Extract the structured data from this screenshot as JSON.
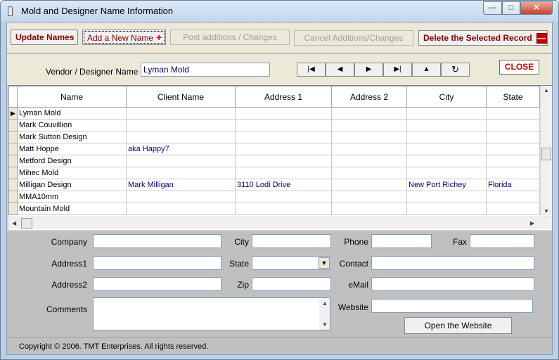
{
  "window": {
    "title": "Mold and Designer Name Information",
    "controls": {
      "minimize": "—",
      "maximize": "□",
      "close": "✕"
    }
  },
  "toolbar": {
    "update_names": "Update Names",
    "add_new_name": "Add a New Name",
    "add_icon": "+",
    "post_changes": "Post additions / Changes",
    "cancel_changes": "Cancel Additions/Changes",
    "delete_record": "Delete the Selected Record",
    "delete_icon": "—"
  },
  "vendor": {
    "label": "Vendor /  Designer Name",
    "value": "Lyman Mold"
  },
  "nav": {
    "first": "|◀",
    "prev": "◀",
    "next": "▶",
    "last": "▶|",
    "up": "▲",
    "refresh": "↻"
  },
  "close_button": "CLOSE",
  "grid": {
    "columns": [
      "Name",
      "Client Name",
      "Address 1",
      "Address 2",
      "City",
      "State"
    ],
    "current_row_marker": "▶",
    "rows": [
      [
        "Lyman Mold",
        "",
        "",
        "",
        "",
        ""
      ],
      [
        "Mark Couvillion",
        "",
        "",
        "",
        "",
        ""
      ],
      [
        "Mark Sutton Design",
        "",
        "",
        "",
        "",
        ""
      ],
      [
        "Matt Hoppe",
        "aka Happy7",
        "",
        "",
        "",
        ""
      ],
      [
        "Metford Design",
        "",
        "",
        "",
        "",
        ""
      ],
      [
        "Mihec Mold",
        "",
        "",
        "",
        "",
        ""
      ],
      [
        "Milligan Design",
        "Mark Milligan",
        "3110 Lodi Drive",
        "",
        "New Port Richey",
        "Florida"
      ],
      [
        "MMA10mm",
        "",
        "",
        "",
        "",
        ""
      ],
      [
        "Mountain Mold",
        "",
        "",
        "",
        "",
        ""
      ]
    ]
  },
  "detail": {
    "company_label": "Company",
    "city_label": "City",
    "phone_label": "Phone",
    "fax_label": "Fax",
    "address1_label": "Address1",
    "state_label": "State",
    "contact_label": "Contact",
    "address2_label": "Address2",
    "zip_label": "Zip",
    "email_label": "eMail",
    "comments_label": "Comments",
    "website_label": "Website",
    "open_website": "Open  the Website"
  },
  "footer": {
    "copyright": "Copyright © 2006. TMT Enterprises. All rights reserved."
  }
}
